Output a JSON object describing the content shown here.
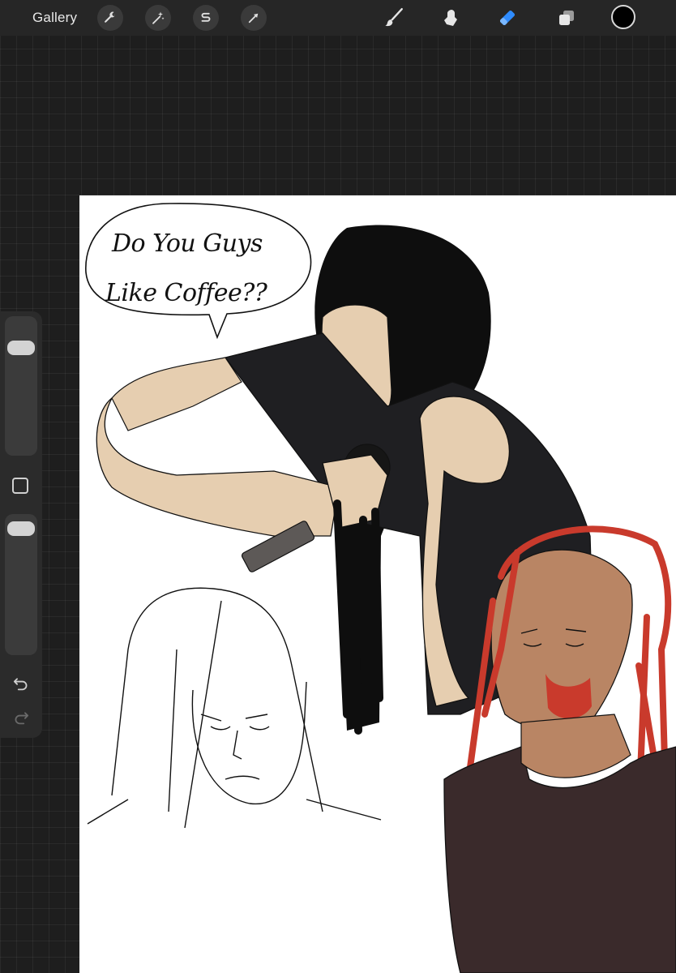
{
  "toolbar": {
    "gallery_label": "Gallery",
    "actions_icon": "wrench-icon",
    "adjustments_icon": "magic-wand-icon",
    "selection_icon": "selection-s-icon",
    "transform_icon": "arrow-cursor-icon",
    "brush_icon": "brush-icon",
    "smudge_icon": "smudge-icon",
    "eraser_icon": "eraser-icon",
    "layers_icon": "layers-icon",
    "active_color": "#000000",
    "active_tool_color": "#2f8cff"
  },
  "canvas": {
    "speech_bubble": {
      "line1": "Do You Guys",
      "line2": "Like Coffee??"
    }
  },
  "sidebar": {
    "brush_size": 0.82,
    "opacity": 0.96,
    "modify_icon": "square-modify-icon",
    "undo_icon": "undo-icon",
    "redo_icon": "redo-icon"
  }
}
